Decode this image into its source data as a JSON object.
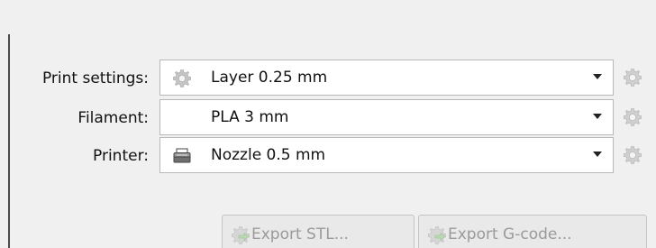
{
  "rows": [
    {
      "label": "Print settings:",
      "value": "Layer 0.25 mm",
      "icon": "gear-icon"
    },
    {
      "label": "Filament:",
      "value": "PLA 3 mm",
      "icon": ""
    },
    {
      "label": "Printer:",
      "value": "Nozzle 0.5 mm",
      "icon": "printer-icon"
    }
  ],
  "buttons": {
    "export_stl": "Export STL...",
    "export_gcode": "Export G-code..."
  },
  "colors": {
    "background": "#f0f0f0",
    "disabled_text": "#9a9a9a",
    "gear_gray": "#bdbdbd"
  }
}
